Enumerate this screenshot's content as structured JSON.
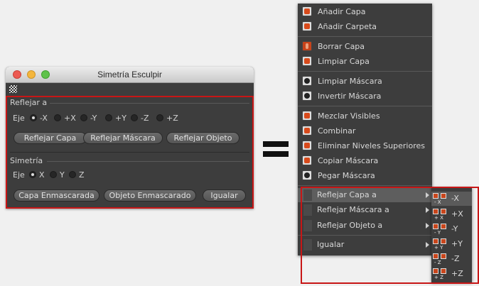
{
  "dialog": {
    "title": "Simetría Esculpir",
    "reflect": {
      "heading": "Reflejar a",
      "axis_label": "Eje",
      "options": [
        "-X",
        "+X",
        "-Y",
        "+Y",
        "-Z",
        "+Z"
      ],
      "selected": "-X",
      "buttons": [
        "Reflejar Capa",
        "Reflejar Máscara",
        "Reflejar Objeto"
      ]
    },
    "symmetry": {
      "heading": "Simetría",
      "axis_label": "Eje",
      "options": [
        "X",
        "Y",
        "Z"
      ],
      "selected": "X",
      "buttons": [
        "Capa Enmascarada",
        "Objeto Enmascarado",
        "Igualar"
      ]
    }
  },
  "menu": {
    "items": [
      "Añadir Capa",
      "Añadir Carpeta",
      "Borrar Capa",
      "Limpiar Capa",
      "Limpiar Máscara",
      "Invertir Máscara",
      "Mezclar Visibles",
      "Combinar",
      "Eliminar Niveles Superiores",
      "Copiar Máscara",
      "Pegar Máscara",
      "Reflejar Capa a",
      "Reflejar Máscara a",
      "Reflejar Objeto a",
      "Igualar"
    ],
    "highlighted": "Reflejar Capa a",
    "submenu": {
      "items": [
        "-X",
        "+X",
        "-Y",
        "+Y",
        "-Z",
        "+Z"
      ],
      "icon_subs": [
        "- X",
        "+ X",
        "- Y",
        "+ Y",
        "- Z",
        "+ Z"
      ],
      "highlighted": "-X"
    }
  },
  "colors": {
    "highlight_box": "#c81616",
    "panel_bg": "#3d3d3d"
  }
}
